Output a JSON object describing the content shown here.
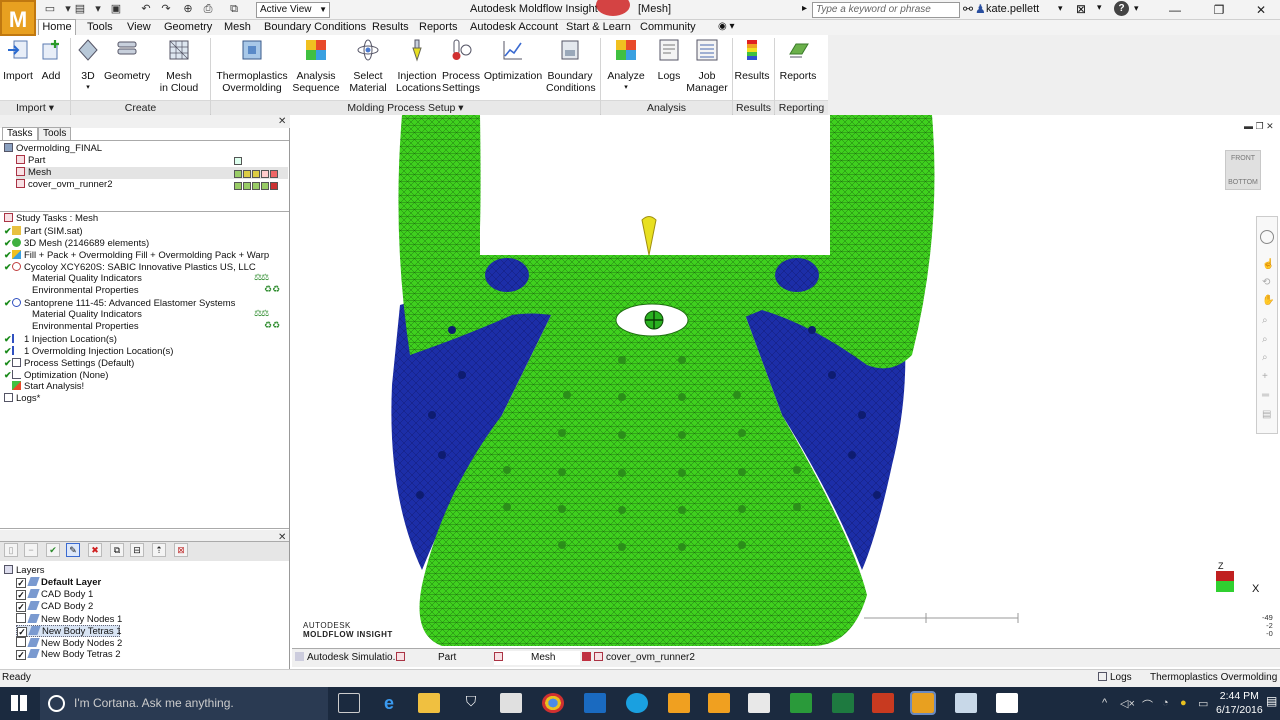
{
  "app": {
    "logo_letter": "M",
    "title": "Autodesk Moldflow Insight",
    "document": "[Mesh]",
    "active_view": "Active View",
    "search_placeholder": "Type a keyword or phrase",
    "user": "kate.pellett"
  },
  "menu_tabs": [
    "Home",
    "Tools",
    "View",
    "Geometry",
    "Mesh",
    "Boundary Conditions",
    "Results",
    "Reports",
    "Autodesk Account",
    "Start & Learn",
    "Community"
  ],
  "ribbon": {
    "buttons": [
      {
        "l1": "Import",
        "l2": ""
      },
      {
        "l1": "Add",
        "l2": ""
      },
      {
        "l1": "3D",
        "l2": ""
      },
      {
        "l1": "Geometry",
        "l2": ""
      },
      {
        "l1": "Mesh",
        "l2": "in Cloud"
      },
      {
        "l1": "Thermoplastics",
        "l2": "Overmolding"
      },
      {
        "l1": "Analysis",
        "l2": "Sequence"
      },
      {
        "l1": "Select",
        "l2": "Material"
      },
      {
        "l1": "Injection",
        "l2": "Locations"
      },
      {
        "l1": "Process",
        "l2": "Settings"
      },
      {
        "l1": "Optimization",
        "l2": ""
      },
      {
        "l1": "Boundary",
        "l2": "Conditions"
      },
      {
        "l1": "Analyze",
        "l2": ""
      },
      {
        "l1": "Logs",
        "l2": ""
      },
      {
        "l1": "Job",
        "l2": "Manager"
      },
      {
        "l1": "Results",
        "l2": ""
      },
      {
        "l1": "Reports",
        "l2": ""
      }
    ],
    "groups": [
      "Import",
      "Create",
      "Molding Process Setup",
      "Analysis",
      "Results",
      "Reporting"
    ]
  },
  "panel_tabs": [
    "Tasks",
    "Tools"
  ],
  "project": {
    "name": "Overmolding_FINAL",
    "items": [
      "Part",
      "Mesh",
      "cover_ovm_runner2"
    ]
  },
  "study": {
    "header": "Study Tasks : Mesh",
    "tasks": [
      "Part (SIM.sat)",
      "3D Mesh (2146689 elements)",
      "Fill + Pack + Overmolding Fill + Overmolding Pack + Warp",
      "Cycoloy XCY620S: SABIC Innovative Plastics US, LLC",
      "Material Quality Indicators",
      "Environmental Properties",
      "Santoprene 111-45: Advanced Elastomer Systems",
      "Material Quality Indicators",
      "Environmental Properties",
      "1 Injection Location(s)",
      "1 Overmolding Injection Location(s)",
      "Process Settings (Default)",
      "Optimization (None)",
      "Start Analysis!",
      "Logs*"
    ]
  },
  "layers": {
    "header": "Layers",
    "items": [
      {
        "name": "Default Layer",
        "checked": true
      },
      {
        "name": "CAD Body 1",
        "checked": true
      },
      {
        "name": "CAD Body 2",
        "checked": true
      },
      {
        "name": "New Body Nodes 1",
        "checked": false
      },
      {
        "name": "New Body Tetras 1",
        "checked": true
      },
      {
        "name": "New Body Nodes 2",
        "checked": false
      },
      {
        "name": "New Body Tetras 2",
        "checked": true
      }
    ]
  },
  "viewport": {
    "logo_line1": "AUTODESK",
    "logo_line2": "MOLDFLOW INSIGHT",
    "cube_front": "FRONT",
    "cube_bottom": "BOTTOM",
    "axis_x": "X",
    "axis_z": "Z",
    "readout": [
      "-49",
      "-2",
      "-0"
    ],
    "colors": {
      "overmold": "#3fd01e",
      "substrate": "#1c2ea8"
    }
  },
  "doc_tabs": [
    "Autodesk Simulatio...",
    "Part",
    "Mesh",
    "cover_ovm_runner2"
  ],
  "status": {
    "left": "Ready",
    "logs": "Logs",
    "mode": "Thermoplastics Overmolding"
  },
  "taskbar": {
    "cortana": "I'm Cortana. Ask me anything.",
    "time": "2:44 PM",
    "date": "6/17/2016"
  }
}
